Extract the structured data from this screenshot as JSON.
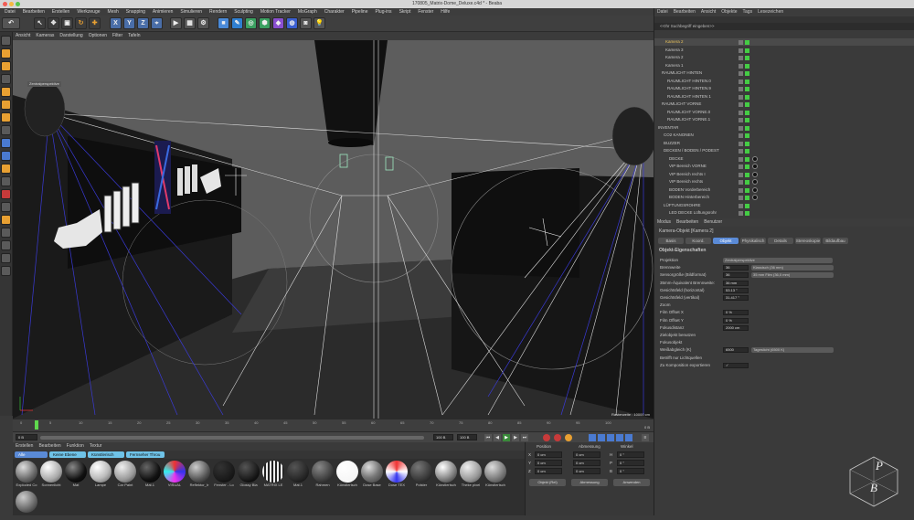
{
  "window": {
    "title": "170805_Matrix-Dome_Deluxe.c4d * - Beaba"
  },
  "colors": {
    "accent": "#5a8ad6",
    "viewport": "#5c5c5c",
    "panel": "#3a3a3a",
    "highlight": "#e8c15a"
  },
  "menubar": [
    "Datei",
    "Bearbeiten",
    "Erstellen",
    "Werkzeuge",
    "Mesh",
    "Snapping",
    "Animieren",
    "Simulieren",
    "Rendern",
    "Sculpting",
    "Motion Tracker",
    "MoGraph",
    "Charakter",
    "Pipeline",
    "Plug-ins",
    "Skript",
    "Fenster",
    "Hilfe"
  ],
  "toolbar": {
    "axis_x": "X",
    "axis_y": "Y",
    "axis_z": "Z"
  },
  "viewport": {
    "menu": [
      "Ansicht",
      "Kameras",
      "Darstellung",
      "Optionen",
      "Filter",
      "Tafeln"
    ],
    "label": "Zentralperspektive",
    "raster": "Rasterweite : 10000 cm"
  },
  "timeline": {
    "ticks": [
      "0",
      "5",
      "10",
      "15",
      "20",
      "25",
      "30",
      "35",
      "40",
      "45",
      "50",
      "55",
      "60",
      "65",
      "70",
      "75",
      "80",
      "85",
      "90",
      "95",
      "100"
    ],
    "current_frame": "0 B",
    "start": "0 B",
    "end": "100 B",
    "end2": "100 B",
    "frame_right": "0 B"
  },
  "materials": {
    "menu": [
      "Erstellen",
      "Bearbeiten",
      "Funktion",
      "Textur"
    ],
    "tabs": [
      "Alle",
      "Keine Ebene",
      "Künstlerisch",
      "Fernseher Throu"
    ],
    "items": [
      "Exploded Co",
      "Sonnenlicht",
      "Mat",
      "Lampe",
      "Car Paint",
      "Mat.1",
      "VISUAL",
      "Reflektor_Ir",
      "Fenster - Lo",
      "Glossy Bla",
      "MATRIX LE",
      "Mat.1",
      "Rahmen",
      "Künstlerisch",
      "Dose Base",
      "Dose TEX",
      "Polster",
      "Künstlerisch",
      "Theke pixel",
      "Künstlerisch",
      ""
    ]
  },
  "coords": {
    "headers": [
      "Position",
      "Abmessung",
      "Winkel"
    ],
    "rows": [
      {
        "axis": "X",
        "pos": "0 cm",
        "size": "0 cm",
        "angle_label": "H",
        "angle": "0 °"
      },
      {
        "axis": "Y",
        "pos": "0 cm",
        "size": "0 cm",
        "angle_label": "P",
        "angle": "0 °"
      },
      {
        "axis": "Z",
        "pos": "0 cm",
        "size": "0 cm",
        "angle_label": "B",
        "angle": "0 °"
      }
    ],
    "mode1": "Objekt (Rel)",
    "mode2": "Abmessung",
    "apply": "Anwenden"
  },
  "objects": {
    "menu": [
      "Datei",
      "Bearbeiten",
      "Ansicht",
      "Objekte",
      "Tags",
      "Lesezeichen"
    ],
    "search": "<<Ihr Suchbegriff eingeben>>",
    "rows": [
      "Kamera 2",
      "Kamera 3",
      "Kamera 2",
      "Kamera 1",
      "RAUMLICHT HINTEN",
      "RAUMLICHT HINTEN.0",
      "RAUMLICHT HINTEN.9",
      "RAUMLICHT HINTEN 1",
      "RAUMLICHT VORNE",
      "RAUMLICHT VORNE.0",
      "RAUMLICHT VORNE.1",
      "INVENTAR",
      "CO2 KANONEN",
      "BUZZER",
      "DECKEN / BODEN / PODEST",
      "DECKE",
      "VIP Bereich VORNE",
      "VIP Bereich rechts I",
      "VIP Bereich rechts",
      "BODEN Vorderbereich",
      "BODEN Hinterbereich",
      "LÜFTUNGSROHRE",
      "LED DECKE Lüftungsrohr"
    ]
  },
  "attributes": {
    "menu": [
      "Modus",
      "Bearbeiten",
      "Benutzer"
    ],
    "title": "Kamera-Objekt [Kamera 2]",
    "tabs": [
      "Basis",
      "Koord.",
      "Objekt",
      "Physikalisch",
      "Details",
      "Stereoskopie",
      "Bildaufbau"
    ],
    "section": "Objekt-Eigenschaften",
    "props": [
      {
        "label": "Projektion",
        "value": "Zentralperspektive"
      },
      {
        "label": "Brennweite",
        "value": "36",
        "extra": "Klassisch (36 mm)"
      },
      {
        "label": "Sensorgröße (Bildformat)",
        "value": "36",
        "extra": "35 mm Film (36,0 mm)"
      },
      {
        "label": "35mm-Äquivalent Brennweite:",
        "value": "36 mm"
      },
      {
        "label": "Gesichtsfeld (horizontal)",
        "value": "53.13 °"
      },
      {
        "label": "Gesichtsfeld (vertikal)",
        "value": "31.417 °"
      },
      {
        "label": "Zoom",
        "value": ""
      },
      {
        "label": "Film Offset X",
        "value": "0 %"
      },
      {
        "label": "Film Offset Y",
        "value": "0 %"
      },
      {
        "label": "Fokusdistanz",
        "value": "2000 cm"
      },
      {
        "label": "Zielobjekt benutzen",
        "value": ""
      },
      {
        "label": "Fokusobjekt",
        "value": ""
      },
      {
        "label": "Weißabgleich (K)",
        "value": "6500",
        "extra": "Tageslicht (6500 K)"
      },
      {
        "label": "Betrifft nur Lichtquellen",
        "value": ""
      },
      {
        "label": "Zu Komposition exportieren",
        "value": "✓"
      }
    ]
  },
  "logo": {
    "text": "PB"
  }
}
